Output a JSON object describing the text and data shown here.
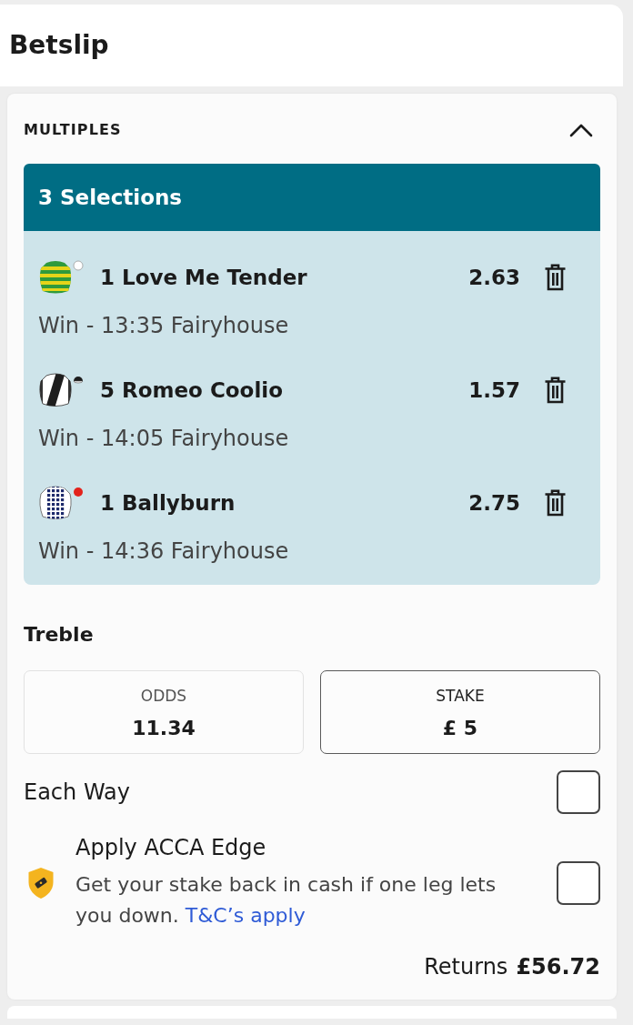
{
  "header": {
    "title": "Betslip"
  },
  "section": {
    "title": "MULTIPLES",
    "expanded": true
  },
  "selections": {
    "title": "3 Selections",
    "items": [
      {
        "kind": "hoops",
        "name": "1 Love Me Tender",
        "odds": "2.63",
        "market": "Win - 13:35 Fairyhouse"
      },
      {
        "kind": "sash",
        "name": "5 Romeo Coolio",
        "odds": "1.57",
        "market": "Win - 14:05 Fairyhouse"
      },
      {
        "kind": "checks",
        "name": "1 Ballyburn",
        "odds": "2.75",
        "market": "Win - 14:36 Fairyhouse"
      }
    ]
  },
  "bet": {
    "title": "Treble",
    "odds": {
      "label": "ODDS",
      "value": "11.34"
    },
    "stake": {
      "label": "STAKE",
      "value": "£ 5"
    }
  },
  "options": [
    {
      "kind": "plain",
      "label": "Each Way",
      "checked": false
    },
    {
      "kind": "promo",
      "label": "Apply ACCA Edge",
      "description": "Get your stake back in cash if one leg lets you down.",
      "link": "T&C’s apply",
      "checked": false
    }
  ],
  "returns": {
    "label": "Returns",
    "value": "£56.72"
  }
}
